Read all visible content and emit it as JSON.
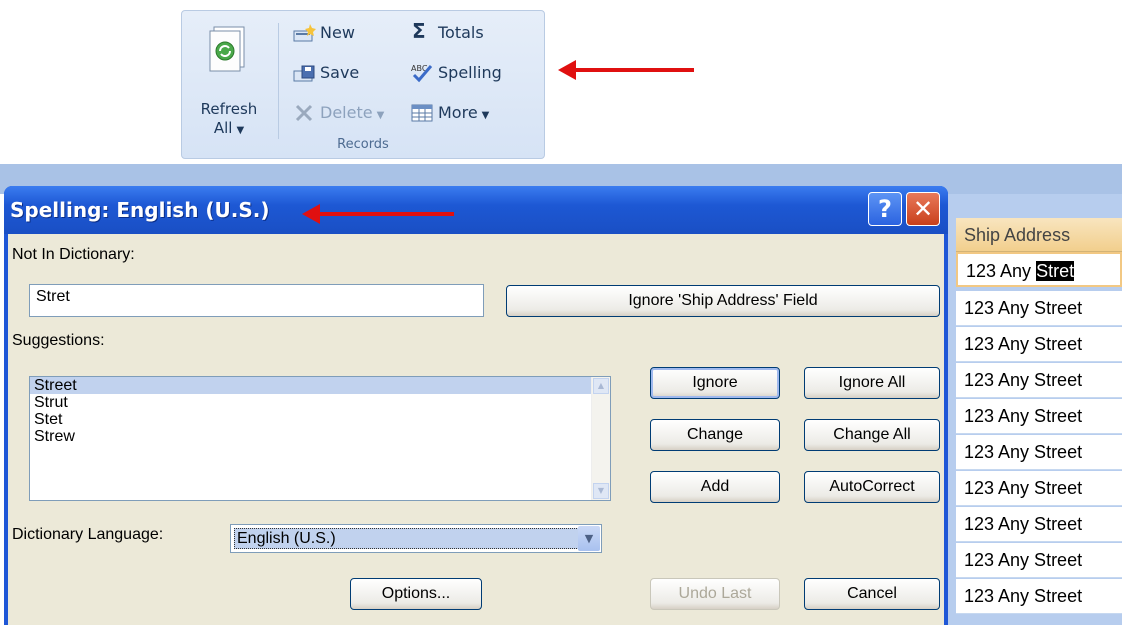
{
  "ribbon": {
    "refresh_label_line1": "Refresh",
    "refresh_label_line2": "All",
    "new_label": "New",
    "save_label": "Save",
    "delete_label": "Delete",
    "totals_label": "Totals",
    "spelling_label": "Spelling",
    "more_label": "More",
    "group_label": "Records",
    "icons": [
      "refresh-icon",
      "new-record-icon",
      "save-icon",
      "delete-icon",
      "totals-icon",
      "spelling-icon",
      "more-icon"
    ]
  },
  "dialog": {
    "title": "Spelling: English (U.S.)",
    "help_glyph": "?",
    "close_glyph": "✕",
    "not_in_dictionary_label": "Not In Dictionary:",
    "not_in_dictionary_value": "Stret",
    "ignore_field_label": "Ignore 'Ship Address' Field",
    "suggestions_label": "Suggestions:",
    "suggestions": [
      "Street",
      "Strut",
      "Stet",
      "Strew"
    ],
    "selected_suggestion": "Street",
    "ignore_label": "Ignore",
    "ignore_all_label": "Ignore All",
    "change_label": "Change",
    "change_all_label": "Change All",
    "add_label": "Add",
    "autocorrect_label": "AutoCorrect",
    "dictionary_language_label": "Dictionary Language:",
    "dictionary_language_value": "English (U.S.)",
    "options_label": "Options...",
    "undo_last_label": "Undo Last",
    "cancel_label": "Cancel"
  },
  "datasheet": {
    "column_header": "Ship Address",
    "active_row_prefix": "123 Any ",
    "active_row_highlight": "Stret",
    "rows": [
      "123 Any Street",
      "123 Any Street",
      "123 Any Street",
      "123 Any Street",
      "123 Any Street",
      "123 Any Street",
      "123 Any Street",
      "123 Any Street"
    ]
  },
  "colors": {
    "annotation_arrow": "#e01010",
    "title_bar": "#1f57d6",
    "column_header": "#f2cf8d"
  }
}
